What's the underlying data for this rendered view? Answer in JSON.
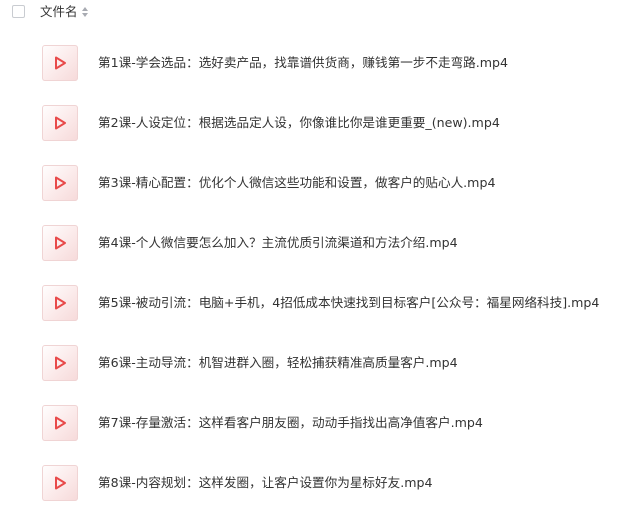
{
  "header": {
    "column_label": "文件名"
  },
  "files": [
    {
      "name": "第1课-学会选品：选好卖产品，找靠谱供货商，赚钱第一步不走弯路.mp4"
    },
    {
      "name": "第2课-人设定位：根据选品定人设，你像谁比你是谁更重要_(new).mp4"
    },
    {
      "name": "第3课-精心配置：优化个人微信这些功能和设置，做客户的贴心人.mp4"
    },
    {
      "name": "第4课-个人微信要怎么加入？主流优质引流渠道和方法介绍.mp4"
    },
    {
      "name": "第5课-被动引流：电脑+手机，4招低成本快速找到目标客户[公众号：福星网络科技].mp4"
    },
    {
      "name": "第6课-主动导流：机智进群入圈，轻松捕获精准高质量客户.mp4"
    },
    {
      "name": "第7课-存量激活：这样看客户朋友圈，动动手指找出高净值客户.mp4"
    },
    {
      "name": "第8课-内容规划：这样发圈，让客户设置你为星标好友.mp4"
    }
  ],
  "icons": {
    "video_file_icon": "video-file-icon",
    "accent": "#e84a4a"
  }
}
